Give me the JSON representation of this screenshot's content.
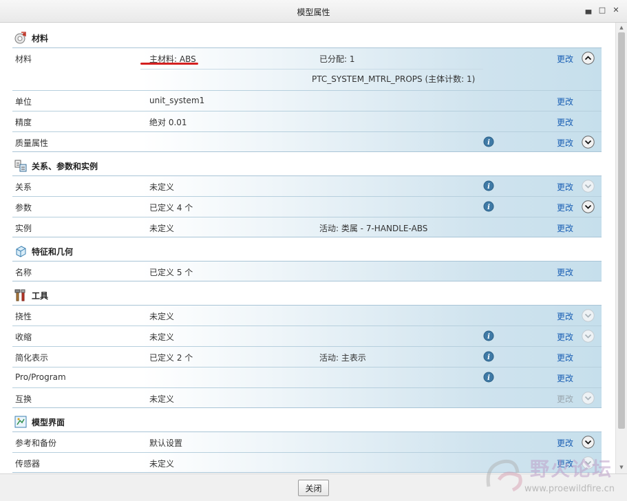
{
  "window": {
    "title": "模型属性"
  },
  "sections": [
    {
      "title": "材料",
      "icon": "material-icon",
      "rows": [
        {
          "label": "材料",
          "value": "主材料: ABS",
          "extra": "已分配: 1",
          "extra2": "PTC_SYSTEM_MTRL_PROPS (主体计数: 1)",
          "info": false,
          "change": "更改",
          "change_enabled": true,
          "chevron": "up"
        },
        {
          "label": "单位",
          "value": "unit_system1",
          "extra": "",
          "info": false,
          "change": "更改",
          "change_enabled": true,
          "chevron": "none"
        },
        {
          "label": "精度",
          "value": "绝对 0.01",
          "extra": "",
          "info": false,
          "change": "更改",
          "change_enabled": true,
          "chevron": "none"
        },
        {
          "label": "质量属性",
          "value": "",
          "extra": "",
          "info": true,
          "change": "更改",
          "change_enabled": true,
          "chevron": "down"
        }
      ]
    },
    {
      "title": "关系、参数和实例",
      "icon": "relations-icon",
      "rows": [
        {
          "label": "关系",
          "value": "未定义",
          "extra": "",
          "info": true,
          "change": "更改",
          "change_enabled": true,
          "chevron": "down-disabled"
        },
        {
          "label": "参数",
          "value": "已定义 4 个",
          "extra": "",
          "info": true,
          "change": "更改",
          "change_enabled": true,
          "chevron": "down"
        },
        {
          "label": "实例",
          "value": "未定义",
          "extra": "活动: 类属 - 7-HANDLE-ABS",
          "info": false,
          "change": "更改",
          "change_enabled": true,
          "chevron": "none"
        }
      ]
    },
    {
      "title": "特征和几何",
      "icon": "features-icon",
      "rows": [
        {
          "label": "名称",
          "value": "已定义 5 个",
          "extra": "",
          "info": false,
          "change": "更改",
          "change_enabled": true,
          "chevron": "none"
        }
      ]
    },
    {
      "title": "工具",
      "icon": "tools-icon",
      "rows": [
        {
          "label": "挠性",
          "value": "未定义",
          "extra": "",
          "info": false,
          "change": "更改",
          "change_enabled": true,
          "chevron": "down-disabled"
        },
        {
          "label": "收缩",
          "value": "未定义",
          "extra": "",
          "info": true,
          "change": "更改",
          "change_enabled": true,
          "chevron": "down-disabled"
        },
        {
          "label": "简化表示",
          "value": "已定义 2 个",
          "extra": "活动: 主表示",
          "info": true,
          "change": "更改",
          "change_enabled": true,
          "chevron": "none"
        },
        {
          "label": "Pro/Program",
          "value": "",
          "extra": "",
          "info": true,
          "change": "更改",
          "change_enabled": true,
          "chevron": "none"
        },
        {
          "label": "互换",
          "value": "未定义",
          "extra": "",
          "info": false,
          "change": "更改",
          "change_enabled": false,
          "chevron": "down-disabled"
        }
      ]
    },
    {
      "title": "模型界面",
      "icon": "model-interface-icon",
      "rows": [
        {
          "label": "参考和备份",
          "value": "默认设置",
          "extra": "",
          "info": false,
          "change": "更改",
          "change_enabled": true,
          "chevron": "down"
        },
        {
          "label": "传感器",
          "value": "未定义",
          "extra": "",
          "info": false,
          "change": "更改",
          "change_enabled": true,
          "chevron": "down-disabled"
        }
      ]
    }
  ],
  "footer": {
    "close_label": "关闭"
  },
  "watermark": {
    "text": "野火论坛",
    "url": "www.proewildfire.cn"
  },
  "colors": {
    "link": "#1a5fb4",
    "row_gradient_end": "#c6dfec",
    "annotation_underline": "#d42020"
  }
}
